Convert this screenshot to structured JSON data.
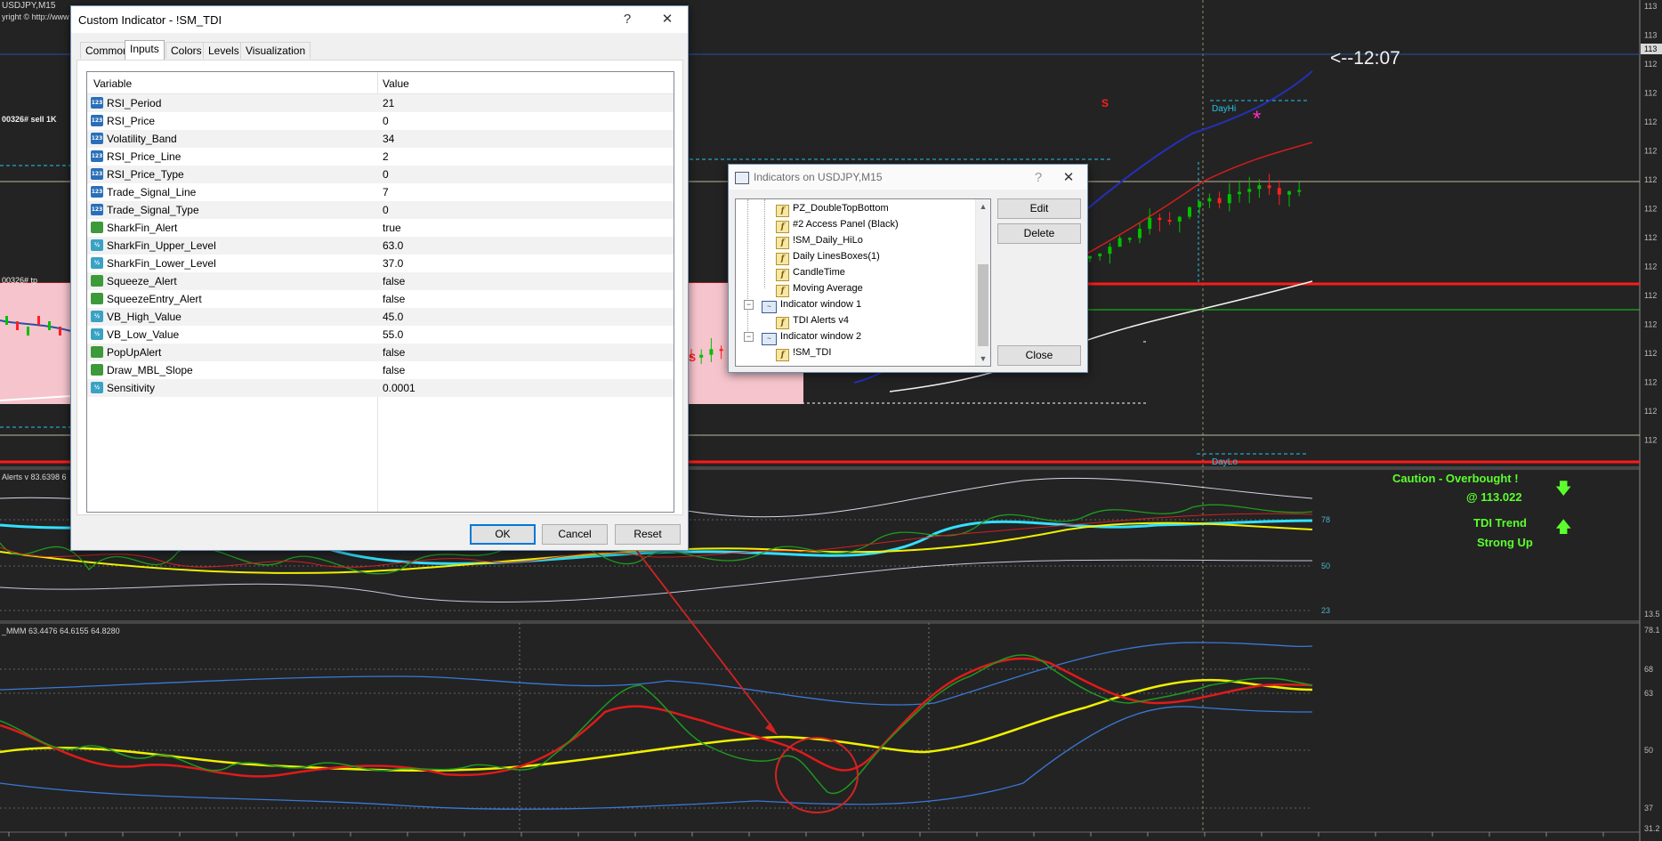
{
  "chart": {
    "symbol_header": "USDJPY,M15",
    "copyright": "yright © http://www",
    "sell_label": "00326# sell 1K",
    "tp_label": "00326# tp",
    "timer": "<--12:07",
    "daily_hi": "DayHi",
    "daily_lo": "DayLo",
    "star_glyph": "*",
    "s_marker": "S",
    "indicator1_label": "Alerts v 83.6398 6",
    "indicator2_label": "_MMM 63.4476 64.6155 64.8280",
    "caution_line1": "Caution - Overbought !",
    "caution_line2": "@ 113.022",
    "trend_line1": "TDI Trend",
    "trend_line2": "Strong Up",
    "arrow_down": "🡇",
    "arrow_up": "🡅",
    "level_labels_1": [
      "78",
      "50",
      "23"
    ],
    "level_labels_2": [
      "68",
      "63",
      "50",
      "37"
    ],
    "right_axis_main": [
      "113",
      "113",
      "112",
      "112",
      "112",
      "112",
      "112",
      "112",
      "112",
      "112",
      "112",
      "112",
      "112",
      "112",
      "112",
      "112"
    ],
    "right_axis_current": "113",
    "right_axis_ind1": "13.5",
    "right_axis_ind2_top": "78.1",
    "right_axis_ind2_bottom": "31.2",
    "colors": {
      "background": "#232323",
      "bull_candle": "#00c000",
      "bear_candle": "#ff2020",
      "rsi_green": "#1e9a1e",
      "signal_red": "#ff1a1a",
      "market_base_yellow": "#f0f000",
      "volatility_band": "#3a78d8",
      "cyan_line": "#33e0ff",
      "caution_text": "#5cff2e"
    }
  },
  "custom_indicator_dialog": {
    "title": "Custom Indicator - !SM_TDI",
    "help_glyph": "?",
    "close_glyph": "✕",
    "tabs": [
      "Common",
      "Inputs",
      "Colors",
      "Levels",
      "Visualization"
    ],
    "active_tab": "Inputs",
    "columns": {
      "variable": "Variable",
      "value": "Value"
    },
    "params": [
      {
        "name": "RSI_Period",
        "value": "21",
        "type": "int",
        "icon": "123"
      },
      {
        "name": "RSI_Price",
        "value": "0",
        "type": "int",
        "icon": "123"
      },
      {
        "name": "Volatility_Band",
        "value": "34",
        "type": "int",
        "icon": "123"
      },
      {
        "name": "RSI_Price_Line",
        "value": "2",
        "type": "int",
        "icon": "123"
      },
      {
        "name": "RSI_Price_Type",
        "value": "0",
        "type": "int",
        "icon": "123"
      },
      {
        "name": "Trade_Signal_Line",
        "value": "7",
        "type": "int",
        "icon": "123"
      },
      {
        "name": "Trade_Signal_Type",
        "value": "0",
        "type": "int",
        "icon": "123"
      },
      {
        "name": "SharkFin_Alert",
        "value": "true",
        "type": "bool",
        "icon": ""
      },
      {
        "name": "SharkFin_Upper_Level",
        "value": "63.0",
        "type": "double",
        "icon": "½"
      },
      {
        "name": "SharkFin_Lower_Level",
        "value": "37.0",
        "type": "double",
        "icon": "½"
      },
      {
        "name": "Squeeze_Alert",
        "value": "false",
        "type": "bool",
        "icon": ""
      },
      {
        "name": "SqueezeEntry_Alert",
        "value": "false",
        "type": "bool",
        "icon": ""
      },
      {
        "name": "VB_High_Value",
        "value": "45.0",
        "type": "double",
        "icon": "½"
      },
      {
        "name": "VB_Low_Value",
        "value": "55.0",
        "type": "double",
        "icon": "½"
      },
      {
        "name": "PopUpAlert",
        "value": "false",
        "type": "bool",
        "icon": ""
      },
      {
        "name": "Draw_MBL_Slope",
        "value": "false",
        "type": "bool",
        "icon": ""
      },
      {
        "name": "Sensitivity",
        "value": "0.0001",
        "type": "double",
        "icon": "½"
      }
    ],
    "buttons": {
      "ok": "OK",
      "cancel": "Cancel",
      "reset": "Reset"
    }
  },
  "indicators_dialog": {
    "title": "Indicators on USDJPY,M15",
    "help_glyph": "?",
    "close_glyph": "✕",
    "items": [
      {
        "label": "PZ_DoubleTopBottom",
        "kind": "indicator",
        "level": 2
      },
      {
        "label": "#2 Access Panel (Black)",
        "kind": "indicator",
        "level": 2
      },
      {
        "label": "!SM_Daily_HiLo",
        "kind": "indicator",
        "level": 2
      },
      {
        "label": "Daily LinesBoxes(1)",
        "kind": "indicator",
        "level": 2
      },
      {
        "label": "CandleTime",
        "kind": "indicator",
        "level": 2
      },
      {
        "label": "Moving Average",
        "kind": "indicator",
        "level": 2
      },
      {
        "label": "Indicator window 1",
        "kind": "window",
        "level": 1
      },
      {
        "label": "TDI Alerts v4",
        "kind": "indicator",
        "level": 2
      },
      {
        "label": "Indicator window 2",
        "kind": "window",
        "level": 1
      },
      {
        "label": "!SM_TDI",
        "kind": "indicator",
        "level": 2
      }
    ],
    "expander_glyph": "−",
    "scroll_up": "▲",
    "scroll_down": "▼",
    "buttons": {
      "edit": "Edit",
      "delete": "Delete",
      "close": "Close"
    }
  }
}
